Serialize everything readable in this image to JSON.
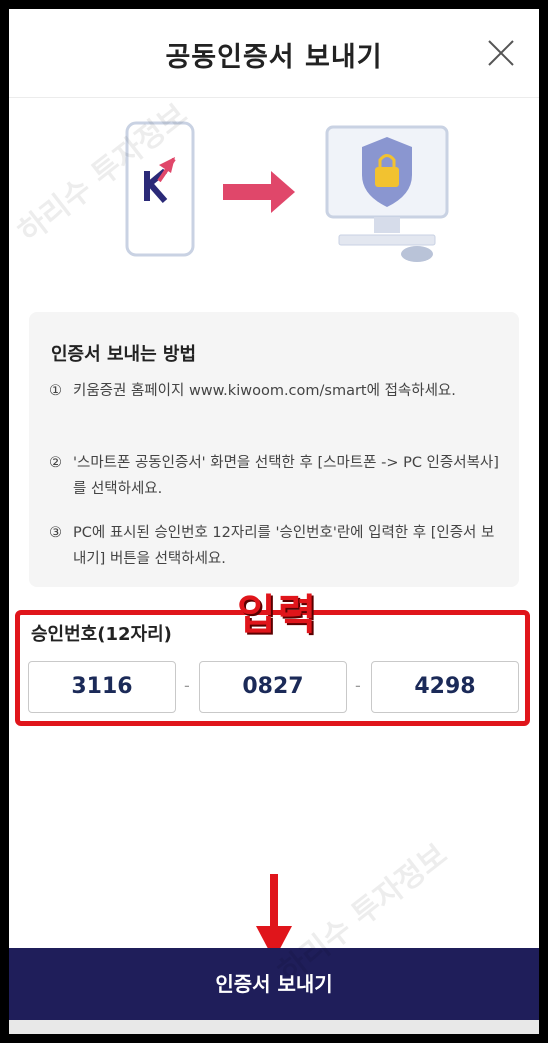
{
  "header": {
    "title": "공동인증서 보내기"
  },
  "illustration": {
    "app_logo_letter": "K"
  },
  "guide": {
    "title": "인증서 보내는 방법",
    "steps": [
      {
        "num": "①",
        "text": "키움증권 홈페이지 www.kiwoom.com/smart에 접속하세요."
      },
      {
        "num": "②",
        "text": "'스마트폰 공동인증서' 화면을 선택한 후 [스마트폰 -> PC 인증서복사]를 선택하세요."
      },
      {
        "num": "③",
        "text": "PC에 표시된 승인번호 12자리를 '승인번호'란에 입력한 후 [인증서 보내기] 버튼을 선택하세요."
      }
    ]
  },
  "annotation": {
    "label": "입력"
  },
  "approval": {
    "label": "승인번호(12자리)",
    "codes": [
      "3116",
      "0827",
      "4298"
    ],
    "separator": "-"
  },
  "send_button": {
    "label": "인증서 보내기"
  },
  "watermark": {
    "text": "하리수 투자정보"
  },
  "colors": {
    "accent_navy": "#1f1e5a",
    "annotation_red": "#e0151b",
    "arrow_pink": "#e0476a"
  }
}
